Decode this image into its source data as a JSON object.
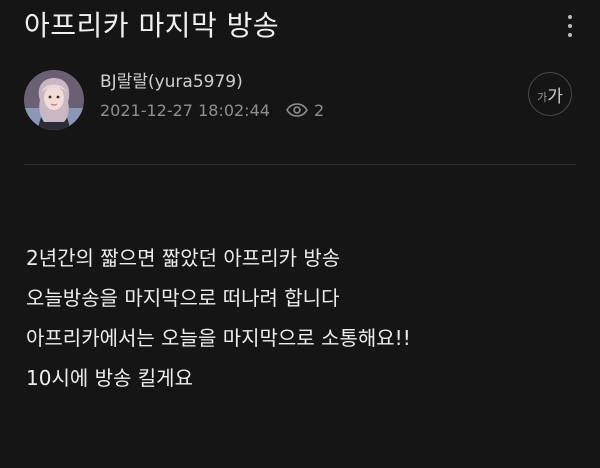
{
  "post": {
    "title": "아프리카 마지막 방송",
    "author": "BJ랄랄(yura5979)",
    "timestamp": "2021-12-27 18:02:44",
    "view_count": "2",
    "body_lines": [
      "2년간의 짧으면 짧았던 아프리카 방송",
      "오늘방송을 마지막으로 떠나려 합니다",
      "아프리카에서는 오늘을 마지막으로 소통해요!!",
      "10시에 방송 킬게요"
    ]
  },
  "toolbar": {
    "font_size_small": "가",
    "font_size_large": "가"
  },
  "icons": {
    "more": "more-vertical-icon",
    "views": "eye-icon"
  },
  "colors": {
    "background": "#151515",
    "text_primary": "#ededed",
    "text_secondary": "#8f8f8f",
    "divider": "#2c2c2c"
  }
}
